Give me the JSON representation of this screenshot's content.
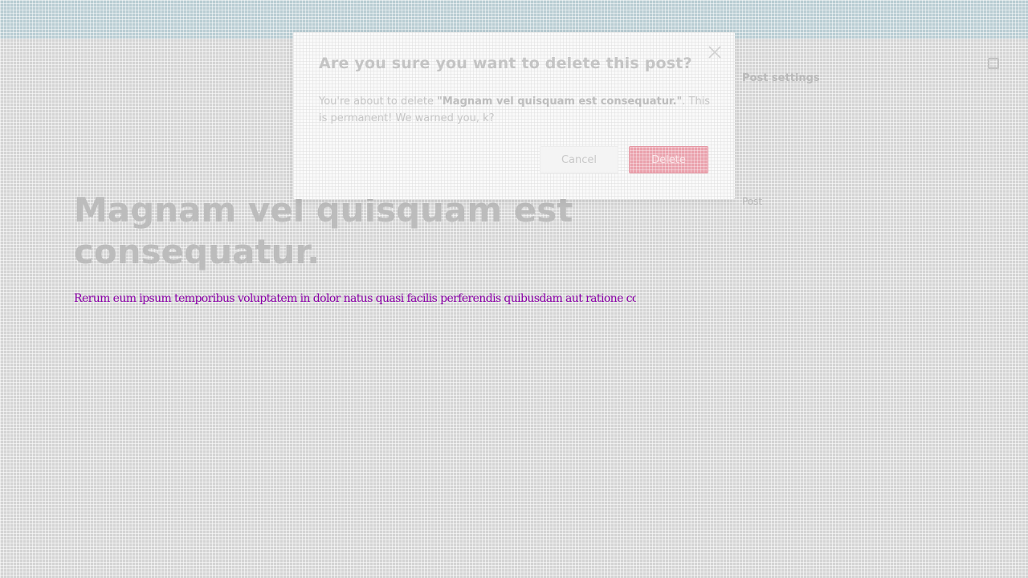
{
  "post": {
    "title": "Magnam vel quisquam est consequatur.",
    "body": "Rerum eum ipsum temporibus voluptatem in dolor natus quasi facilis perferendis quibusdam aut ratione consequatur."
  },
  "sidebar": {
    "heading": "Post settings",
    "section": "Post"
  },
  "modal": {
    "title": "Are you sure you want to delete this post?",
    "message_prefix": "You're about to delete ",
    "message_post_title": "\"Magnam vel quisquam est consequatur.\"",
    "message_suffix": ". This is permanent! We warned you, k?",
    "cancel_label": "Cancel",
    "delete_label": "Delete"
  },
  "icons": {
    "close": "close-icon",
    "sidebar_toggle": "sidebar-toggle-icon"
  },
  "colors": {
    "danger": "#e5707f",
    "overlay": "#d4d4d4",
    "topbar": "#b9cdd3",
    "body_text": "#8b00a8"
  }
}
